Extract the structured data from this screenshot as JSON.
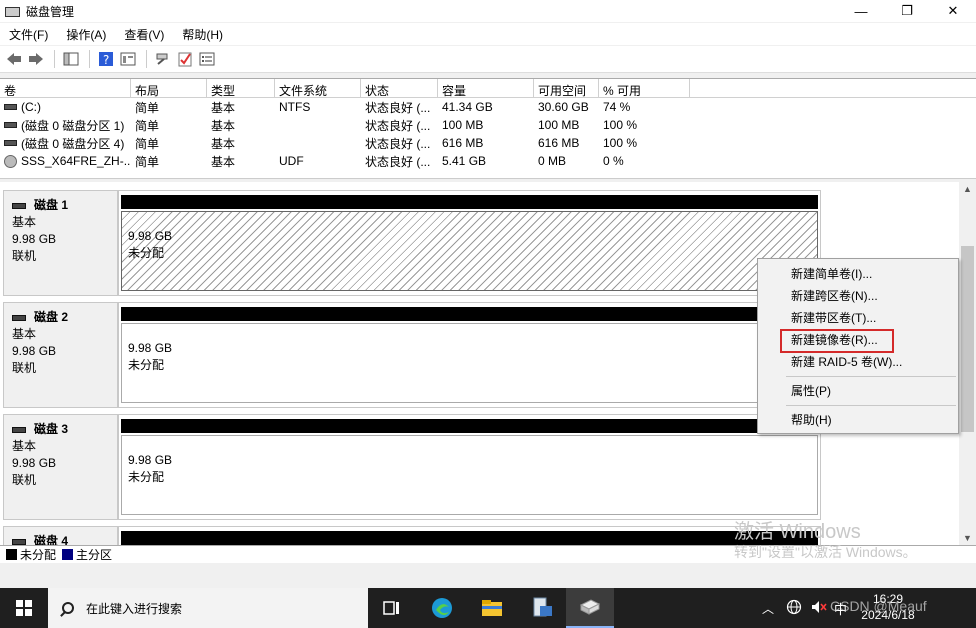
{
  "window": {
    "title": "磁盘管理",
    "minimize_glyph": "—",
    "restore_glyph": "❐",
    "close_glyph": "✕"
  },
  "menu": [
    "文件(F)",
    "操作(A)",
    "查看(V)",
    "帮助(H)"
  ],
  "toolbar": {
    "icons": [
      "back-arrow-icon",
      "forward-arrow-icon",
      "console-tree-icon",
      "help-icon",
      "properties-icon",
      "connect-icon",
      "check-icon",
      "settings-icon"
    ]
  },
  "volume_table": {
    "headers": [
      "卷",
      "布局",
      "类型",
      "文件系统",
      "状态",
      "容量",
      "可用空间",
      "% 可用"
    ],
    "rows": [
      {
        "icon": "drive-icon",
        "cells": [
          "(C:)",
          "简单",
          "基本",
          "NTFS",
          "状态良好 (...",
          "41.34 GB",
          "30.60 GB",
          "74 %"
        ]
      },
      {
        "icon": "drive-icon",
        "cells": [
          "(磁盘 0 磁盘分区 1)",
          "简单",
          "基本",
          "",
          "状态良好 (...",
          "100 MB",
          "100 MB",
          "100 %"
        ]
      },
      {
        "icon": "drive-icon",
        "cells": [
          "(磁盘 0 磁盘分区 4)",
          "简单",
          "基本",
          "",
          "状态良好 (...",
          "616 MB",
          "616 MB",
          "100 %"
        ]
      },
      {
        "icon": "cd-icon",
        "cells": [
          "SSS_X64FRE_ZH-...",
          "简单",
          "基本",
          "UDF",
          "状态良好 (...",
          "5.41 GB",
          "0 MB",
          "0 %"
        ]
      }
    ]
  },
  "disks": [
    {
      "name": "磁盘 1",
      "type": "基本",
      "size": "9.98 GB",
      "status": "联机",
      "part_size": "9.98 GB",
      "part_state": "未分配"
    },
    {
      "name": "磁盘 2",
      "type": "基本",
      "size": "9.98 GB",
      "status": "联机",
      "part_size": "9.98 GB",
      "part_state": "未分配"
    },
    {
      "name": "磁盘 3",
      "type": "基本",
      "size": "9.98 GB",
      "status": "联机",
      "part_size": "9.98 GB",
      "part_state": "未分配"
    },
    {
      "name": "磁盘 4",
      "type": "",
      "size": "",
      "status": "",
      "part_size": "",
      "part_state": ""
    }
  ],
  "legend": [
    {
      "label": "未分配",
      "color": "#000000"
    },
    {
      "label": "主分区",
      "color": "#000080"
    }
  ],
  "context_menu": {
    "items": [
      {
        "label": "新建简单卷(I)...",
        "highlighted": false
      },
      {
        "label": "新建跨区卷(N)...",
        "highlighted": false
      },
      {
        "label": "新建带区卷(T)...",
        "highlighted": false
      },
      {
        "label": "新建镜像卷(R)...",
        "highlighted": true
      },
      {
        "label": "新建 RAID-5 卷(W)...",
        "highlighted": false
      },
      {
        "label": "属性(P)",
        "highlighted": false
      },
      {
        "label": "帮助(H)",
        "highlighted": false
      }
    ]
  },
  "watermark": {
    "line1": "激活 Windows",
    "line2": "转到\"设置\"以激活 Windows。"
  },
  "taskbar": {
    "search_placeholder": "在此键入进行搜索",
    "ime": "中",
    "time": "16:29",
    "date": "2024/6/18",
    "overlay": "CSDN @Meauf"
  },
  "colors": {
    "highlight_box": "#d42a2a",
    "unallocated": "#000000",
    "primary_partition": "#000080"
  }
}
